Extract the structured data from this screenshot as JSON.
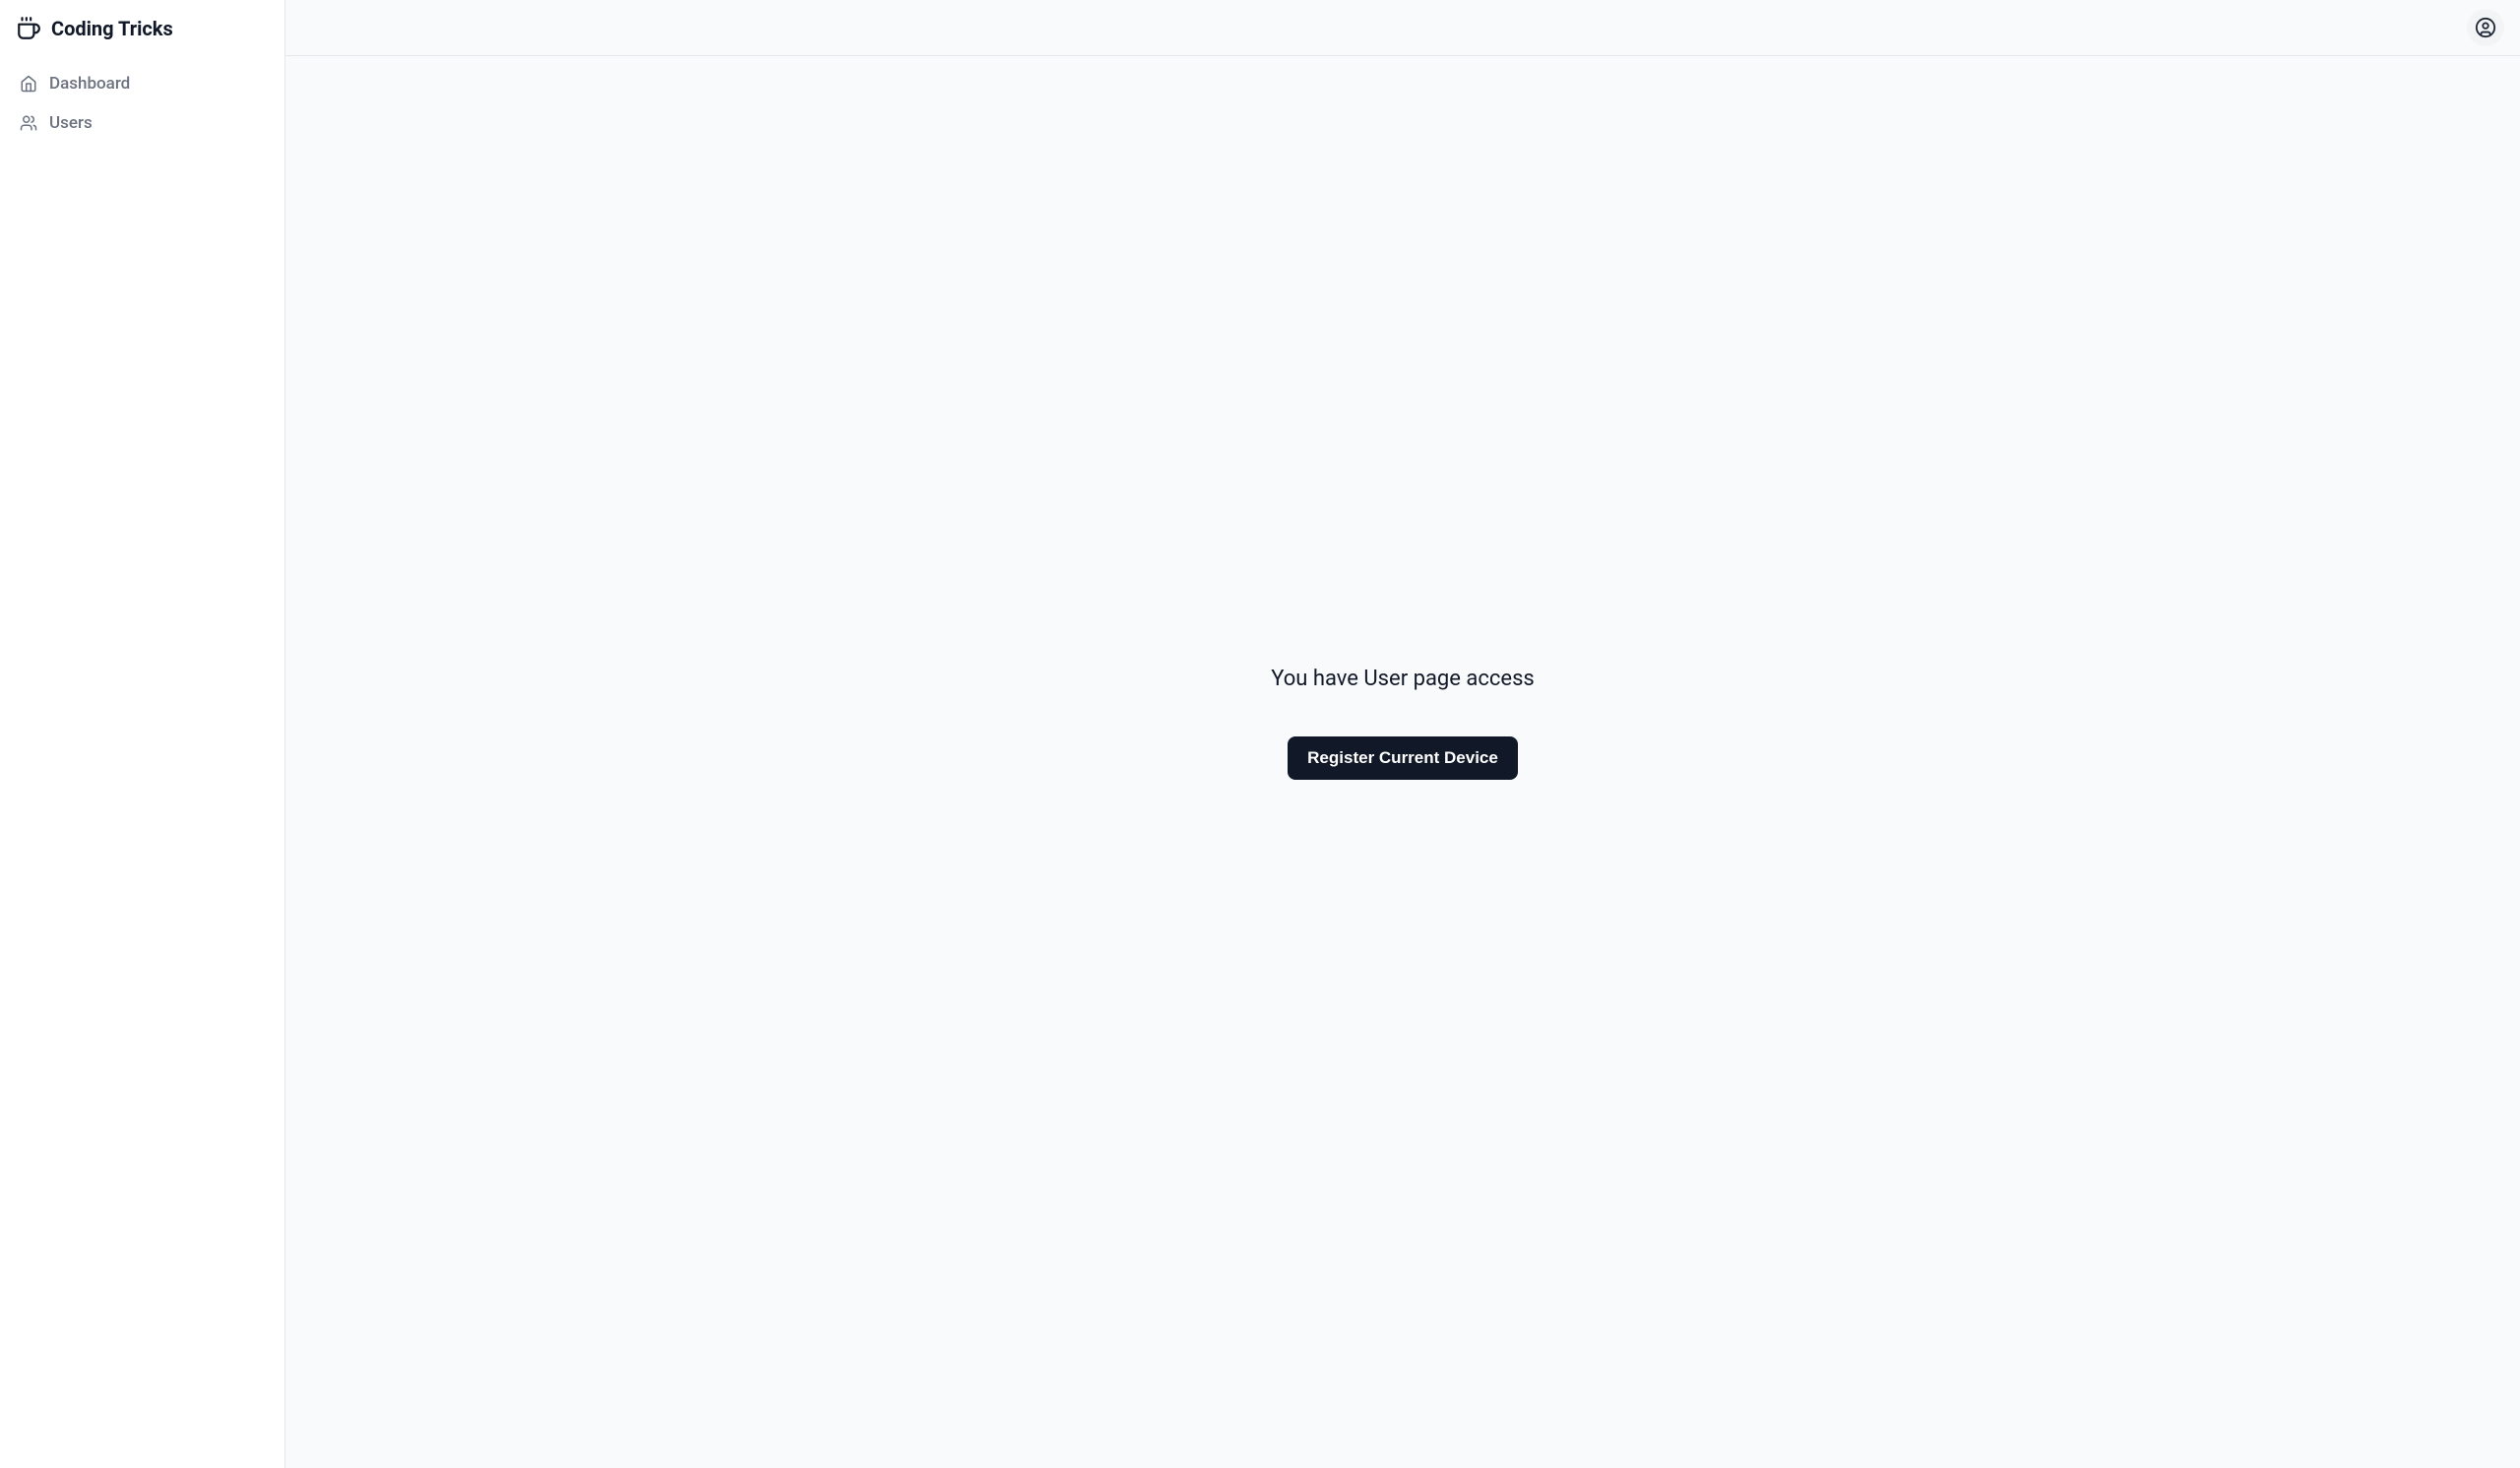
{
  "brand": {
    "title": "Coding Tricks"
  },
  "sidebar": {
    "items": [
      {
        "label": "Dashboard"
      },
      {
        "label": "Users"
      }
    ]
  },
  "main": {
    "message": "You have User page access",
    "register_button": "Register Current Device"
  }
}
